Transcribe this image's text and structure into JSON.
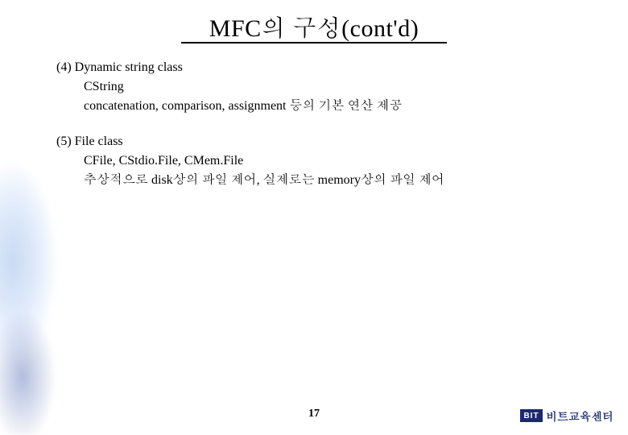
{
  "title": "MFC의 구성(cont'd)",
  "sections": [
    {
      "head": "(4) Dynamic string class",
      "lines": [
        "CString",
        "concatenation, comparison, assignment 등의 기본 연산 제공"
      ]
    },
    {
      "head": "(5) File class",
      "lines": [
        "CFile, CStdio.File, CMem.File",
        "추상적으로 disk상의 파일 제어, 실제로는 memory상의 파일 제어"
      ]
    }
  ],
  "pageNumber": "17",
  "footer": {
    "logoAbbr": "BIT",
    "logoText": "비트교육센터"
  }
}
